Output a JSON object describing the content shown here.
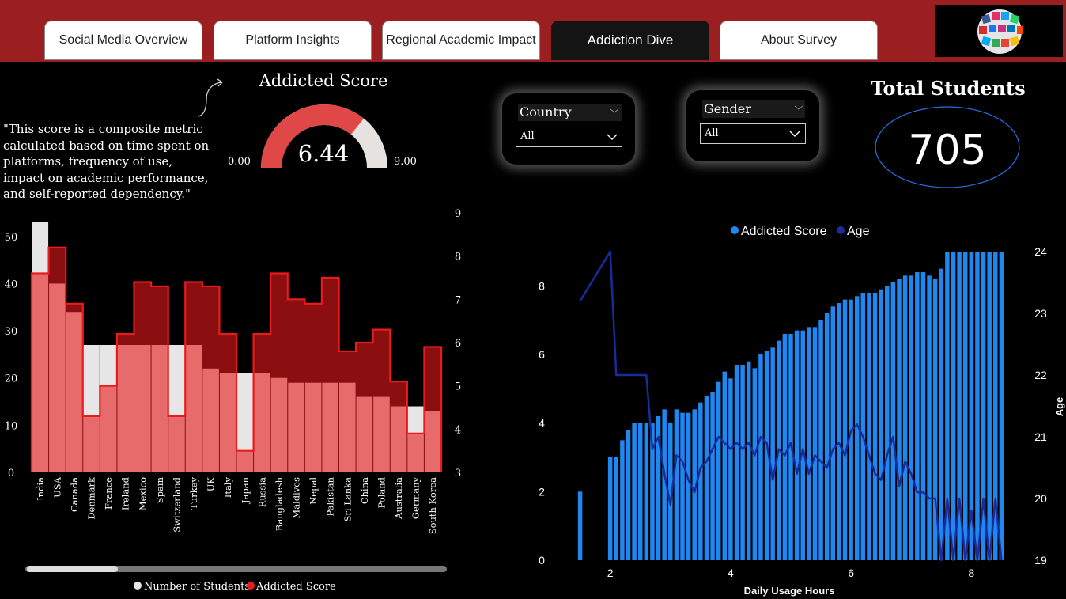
{
  "tabs": [
    {
      "label": "Social Media Overview"
    },
    {
      "label": "Platform Insights"
    },
    {
      "label": "Regional Academic Impact"
    },
    {
      "label": "Addiction Dive"
    },
    {
      "label": "About Survey"
    }
  ],
  "gauge": {
    "title": "Addicted Score",
    "value": 6.44,
    "value_label": "6.44",
    "min_label": "0.00",
    "max_label": "9.00",
    "min": 0,
    "max": 9
  },
  "description": "\"This score is a composite metric calculated based on time spent on platforms, frequency of use, impact on academic performance, and self-reported dependency.\"",
  "filters": {
    "country": {
      "label": "Country",
      "value": "All"
    },
    "gender": {
      "label": "Gender",
      "value": "All"
    }
  },
  "kpi": {
    "title": "Total Students",
    "value": "705"
  },
  "colors": {
    "accent": "#9b1f21",
    "bar_light": "#e86b6b",
    "bar_grey": "#e6e6e6",
    "area_red": "#8b0e10",
    "line_red": "#e81c1c",
    "blue_bar": "#1e88f0",
    "line_navy": "#1a2b9a"
  },
  "legend_left": [
    {
      "name": "Number of Students",
      "color": "#e6e6e6"
    },
    {
      "name": "Addicted Score",
      "color": "#e81c1c"
    }
  ],
  "legend_right": [
    {
      "name": "Addicted Score",
      "color": "#1e88f0"
    },
    {
      "name": "Age",
      "color": "#1a2b9a"
    }
  ],
  "chart_data": [
    {
      "type": "bar",
      "categories": [
        "India",
        "USA",
        "Canada",
        "Denmark",
        "France",
        "Ireland",
        "Mexico",
        "Spain",
        "Switzerland",
        "Turkey",
        "UK",
        "Italy",
        "Japan",
        "Russia",
        "Bangladesh",
        "Maldives",
        "Nepal",
        "Pakistan",
        "Sri Lanka",
        "China",
        "Poland",
        "Australia",
        "Germany",
        "South Korea"
      ],
      "series": [
        {
          "name": "Number of Students",
          "values": [
            53,
            40,
            34,
            27,
            27,
            27,
            27,
            27,
            27,
            27,
            22,
            21,
            21,
            21,
            20,
            19,
            19,
            19,
            19,
            16,
            16,
            14,
            14,
            13
          ]
        },
        {
          "name": "Addicted Score",
          "values": [
            7.6,
            8.2,
            6.9,
            4.3,
            5.0,
            6.2,
            7.4,
            7.3,
            4.3,
            7.4,
            7.3,
            6.2,
            3.5,
            6.2,
            7.6,
            7.0,
            6.9,
            7.5,
            5.8,
            6.0,
            6.3,
            5.1,
            3.9,
            5.9
          ]
        }
      ],
      "y_ticks": [
        "0",
        "10",
        "20",
        "30",
        "40",
        "50"
      ],
      "y2_ticks": [
        "3",
        "4",
        "5",
        "6",
        "7",
        "8",
        "9"
      ],
      "ylim": [
        0,
        55
      ],
      "y2lim": [
        3,
        9
      ]
    },
    {
      "type": "bar",
      "xlabel": "Daily Usage Hours",
      "y2label": "Age",
      "x_ticks": [
        "2",
        "4",
        "6",
        "8"
      ],
      "y_ticks": [
        "0",
        "2",
        "4",
        "6",
        "8"
      ],
      "y2_ticks": [
        "19",
        "20",
        "21",
        "22",
        "23",
        "24"
      ],
      "xlim": [
        1.4,
        8.6
      ],
      "ylim": [
        0,
        9
      ],
      "y2lim": [
        19,
        24
      ],
      "x": [
        1.5,
        2.0,
        2.1,
        2.2,
        2.3,
        2.4,
        2.5,
        2.6,
        2.7,
        2.8,
        2.9,
        3.0,
        3.1,
        3.2,
        3.3,
        3.4,
        3.5,
        3.6,
        3.7,
        3.8,
        3.9,
        4.0,
        4.1,
        4.2,
        4.3,
        4.4,
        4.5,
        4.6,
        4.7,
        4.8,
        4.9,
        5.0,
        5.1,
        5.2,
        5.3,
        5.4,
        5.5,
        5.6,
        5.7,
        5.8,
        5.9,
        6.0,
        6.1,
        6.2,
        6.3,
        6.4,
        6.5,
        6.6,
        6.7,
        6.8,
        6.9,
        7.0,
        7.1,
        7.2,
        7.3,
        7.4,
        7.5,
        7.6,
        7.7,
        7.8,
        7.9,
        8.0,
        8.1,
        8.2,
        8.3,
        8.4,
        8.5
      ],
      "series": [
        {
          "name": "Addicted Score",
          "values": [
            2.0,
            3.0,
            3.0,
            3.5,
            3.8,
            4.0,
            4.0,
            4.0,
            4.0,
            4.2,
            4.4,
            4.0,
            4.4,
            4.3,
            4.3,
            4.4,
            4.6,
            4.8,
            4.9,
            5.2,
            5.5,
            5.3,
            5.7,
            5.7,
            5.8,
            5.6,
            6.0,
            6.1,
            6.2,
            6.4,
            6.6,
            6.6,
            6.7,
            6.7,
            6.8,
            6.8,
            7.0,
            7.2,
            7.4,
            7.5,
            7.6,
            7.6,
            7.7,
            7.8,
            7.8,
            7.8,
            7.9,
            8.0,
            8.1,
            8.2,
            8.3,
            8.3,
            8.4,
            8.4,
            8.3,
            8.2,
            8.5,
            9.0,
            9.0,
            9.0,
            9.0,
            9.0,
            9.0,
            9.0,
            9.0,
            9.0,
            9.0
          ]
        },
        {
          "name": "Age",
          "values": [
            23.2,
            24.0,
            22.0,
            22.0,
            22.0,
            22.0,
            22.0,
            22.0,
            20.8,
            21.0,
            20.4,
            19.9,
            20.7,
            20.6,
            20.3,
            20.1,
            20.5,
            20.6,
            20.8,
            21.0,
            20.9,
            20.8,
            20.9,
            20.8,
            20.9,
            20.7,
            21.0,
            20.9,
            20.3,
            20.8,
            20.7,
            20.9,
            20.4,
            20.8,
            20.4,
            20.7,
            20.6,
            20.5,
            20.8,
            20.9,
            20.7,
            21.1,
            21.2,
            21.0,
            20.7,
            20.4,
            20.3,
            20.7,
            21.0,
            20.2,
            20.6,
            20.4,
            20.1,
            20.1,
            20.0,
            20.0,
            19.0,
            20.0,
            19.0,
            20.0,
            19.0,
            19.8,
            19.0,
            20.0,
            19.0,
            20.0,
            19.0
          ]
        }
      ]
    }
  ]
}
